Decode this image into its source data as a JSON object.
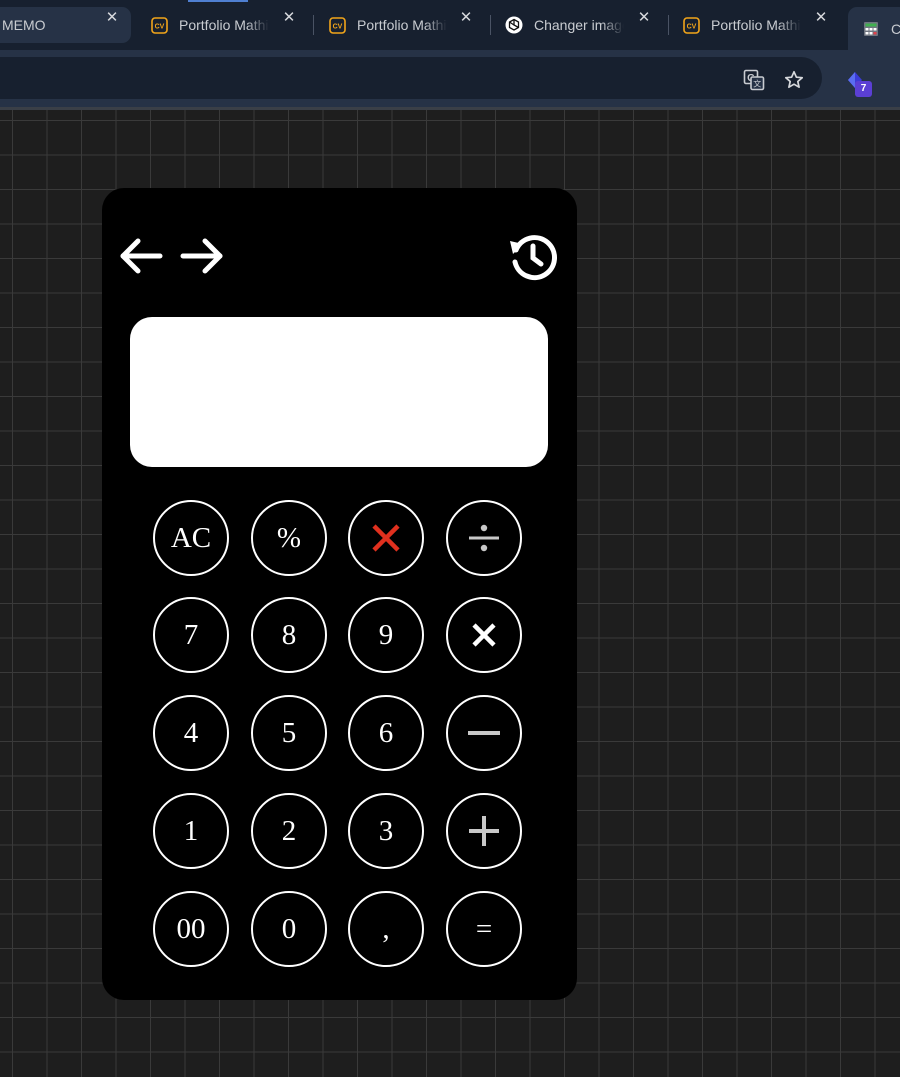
{
  "browser": {
    "tabs": [
      {
        "title": "MEMO",
        "icon": "none"
      },
      {
        "title": "Portfolio Mathieu",
        "icon": "cv-icon"
      },
      {
        "title": "Portfolio Mathieu",
        "icon": "cv-icon"
      },
      {
        "title": "Changer image",
        "icon": "openai-icon"
      },
      {
        "title": "Portfolio Mathieu",
        "icon": "cv-icon"
      },
      {
        "title": "Ca",
        "icon": "calculator-icon"
      }
    ],
    "close_glyph": "✕",
    "extension_badge": "7",
    "toolbar_icons": [
      "translate-icon",
      "bookmark-star-icon",
      "extension-icon"
    ]
  },
  "calculator": {
    "display_value": "",
    "nav": [
      "back-arrow-icon",
      "forward-arrow-icon",
      "history-icon"
    ],
    "keys": {
      "clear": "AC",
      "percent": "%",
      "delete": "delete-x-icon",
      "divide": "÷",
      "seven": "7",
      "eight": "8",
      "nine": "9",
      "multiply": "×",
      "four": "4",
      "five": "5",
      "six": "6",
      "minus": "−",
      "one": "1",
      "two": "2",
      "three": "3",
      "plus": "+",
      "double_zero": "00",
      "zero": "0",
      "comma": ",",
      "equals": "="
    },
    "colors": {
      "delete": "#e0301e",
      "operator": "#c8c8c8",
      "key_border": "#ffffff",
      "body": "#000000",
      "display": "#ffffff"
    }
  }
}
